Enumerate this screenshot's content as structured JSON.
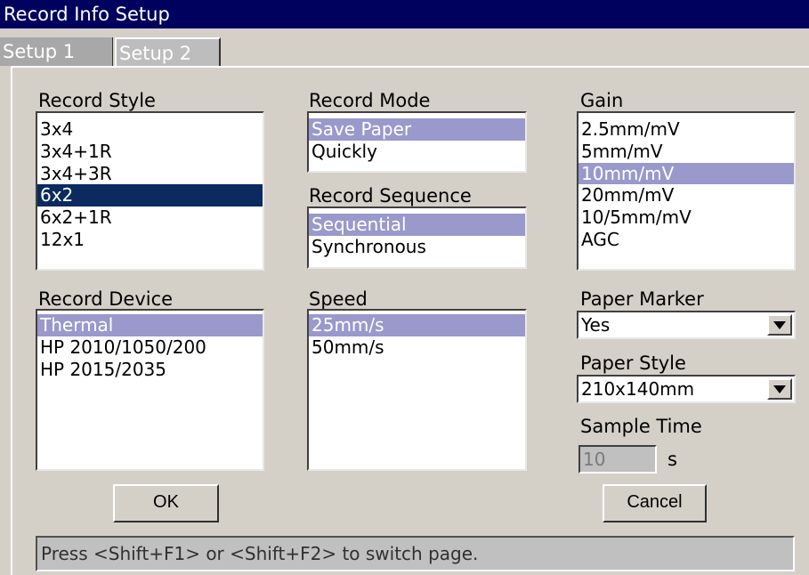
{
  "window": {
    "title": "Record Info Setup"
  },
  "tabs": [
    {
      "label": "Setup 1",
      "active": true
    },
    {
      "label": "Setup 2",
      "active": false
    }
  ],
  "record_style": {
    "label": "Record Style",
    "items": [
      "3x4",
      "3x4+1R",
      "3x4+3R",
      "6x2",
      "6x2+1R",
      "12x1"
    ],
    "selected": "6x2"
  },
  "record_mode": {
    "label": "Record Mode",
    "items": [
      "Save Paper",
      "Quickly"
    ],
    "selected": "Save Paper"
  },
  "record_sequence": {
    "label": "Record Sequence",
    "items": [
      "Sequential",
      "Synchronous"
    ],
    "selected": "Sequential"
  },
  "gain": {
    "label": "Gain",
    "items": [
      "2.5mm/mV",
      "5mm/mV",
      "10mm/mV",
      "20mm/mV",
      "10/5mm/mV",
      "AGC"
    ],
    "selected": "10mm/mV"
  },
  "record_device": {
    "label": "Record Device",
    "items": [
      "Thermal",
      "HP 2010/1050/200",
      "HP 2015/2035"
    ],
    "selected": "Thermal"
  },
  "speed": {
    "label": "Speed",
    "items": [
      "25mm/s",
      "50mm/s"
    ],
    "selected": "25mm/s"
  },
  "paper_marker": {
    "label": "Paper Marker",
    "value": "Yes",
    "icon": "dropdown-arrow-icon"
  },
  "paper_style": {
    "label": "Paper Style",
    "value": "210x140mm",
    "icon": "dropdown-arrow-icon"
  },
  "sample_time": {
    "label": "Sample Time",
    "value": "10",
    "unit": "s"
  },
  "buttons": {
    "ok": "OK",
    "cancel": "Cancel"
  },
  "status": {
    "text": "Press <Shift+F1> or <Shift+F2> to switch page."
  },
  "colors": {
    "titlebar": "#00015e",
    "selection_highlight": "#9999cc",
    "selection_dark": "#0a2a60",
    "background": "#d4d0c8"
  }
}
